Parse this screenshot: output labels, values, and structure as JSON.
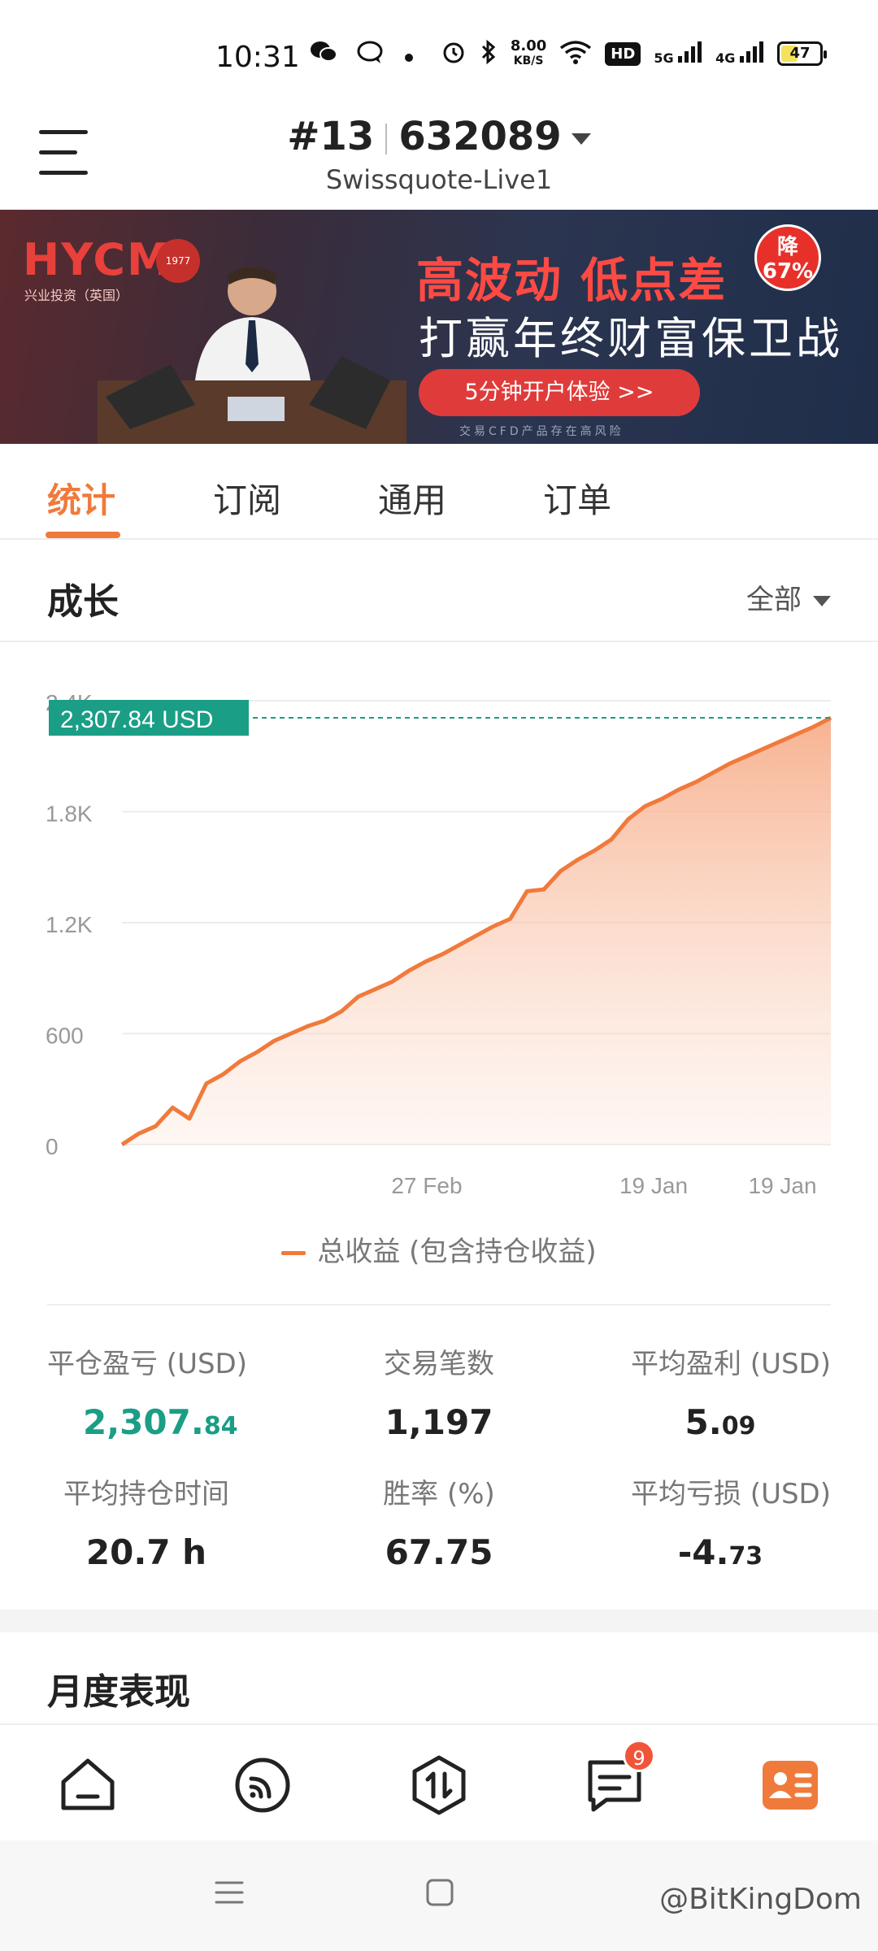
{
  "status_bar": {
    "time": "10:31",
    "speed_value": "8.00",
    "speed_unit": "KB/S",
    "hd": "HD",
    "net1": "5G",
    "net2": "4G",
    "battery": "47"
  },
  "header": {
    "account_number": "#13",
    "account_id": "632089",
    "server": "Swissquote-Live1"
  },
  "banner": {
    "logo": "HYCM",
    "logo_sub": "兴业投资（英国）",
    "seal": "1977",
    "headline": "高波动 低点差",
    "subline": "打赢年终财富保卫战",
    "badge_line1": "降",
    "badge_line2": "67%",
    "cta": "5分钟开户体验 >>",
    "disclaimer": "交易CFD产品存在高风险"
  },
  "tabs": [
    {
      "label": "统计",
      "active": true
    },
    {
      "label": "订阅",
      "active": false
    },
    {
      "label": "通用",
      "active": false
    },
    {
      "label": "订单",
      "active": false
    }
  ],
  "growth": {
    "title": "成长",
    "range": "全部"
  },
  "chart_data": {
    "type": "area",
    "y_ticks": [
      "0",
      "600",
      "1.2K",
      "1.8K",
      "2.4K"
    ],
    "ylim": [
      0,
      2400
    ],
    "x_ticks": [
      "27 Feb",
      "19 Jan",
      "19 Jan"
    ],
    "current_value_label": "2,307.84 USD",
    "current_value": 2307.84,
    "series": [
      {
        "name": "总收益 (包含持仓收益)",
        "color": "#f07a3c",
        "values": [
          0,
          60,
          100,
          200,
          140,
          330,
          380,
          450,
          500,
          560,
          600,
          640,
          670,
          720,
          800,
          840,
          880,
          940,
          990,
          1030,
          1080,
          1130,
          1180,
          1220,
          1370,
          1380,
          1480,
          1540,
          1590,
          1650,
          1760,
          1830,
          1870,
          1920,
          1960,
          2010,
          2060,
          2100,
          2140,
          2180,
          2220,
          2260,
          2307.84
        ]
      }
    ]
  },
  "stats": [
    {
      "label": "平仓盈亏 (USD)",
      "int": "2,307.",
      "dec": "84",
      "green": true
    },
    {
      "label": "交易笔数",
      "int": "1,197",
      "dec": "",
      "green": false
    },
    {
      "label": "平均盈利 (USD)",
      "int": "5.",
      "dec": "09",
      "green": false
    },
    {
      "label": "平均持仓时间",
      "int": "20.7 h",
      "dec": "",
      "green": false
    },
    {
      "label": "胜率 (%)",
      "int": "67.75",
      "dec": "",
      "green": false
    },
    {
      "label": "平均亏损 (USD)",
      "int": "-4.",
      "dec": "73",
      "green": false
    }
  ],
  "monthly": {
    "title": "月度表现"
  },
  "bottom_nav": {
    "messages_badge": "9",
    "accent": "#f07a3c"
  },
  "watermark": "@BitKingDom",
  "icons": [
    "wechat-icon",
    "chat-icon",
    "alarm-icon",
    "bluetooth-icon",
    "wifi-icon",
    "home-icon",
    "feed-icon",
    "trade-icon",
    "messages-icon",
    "profile-icon"
  ]
}
